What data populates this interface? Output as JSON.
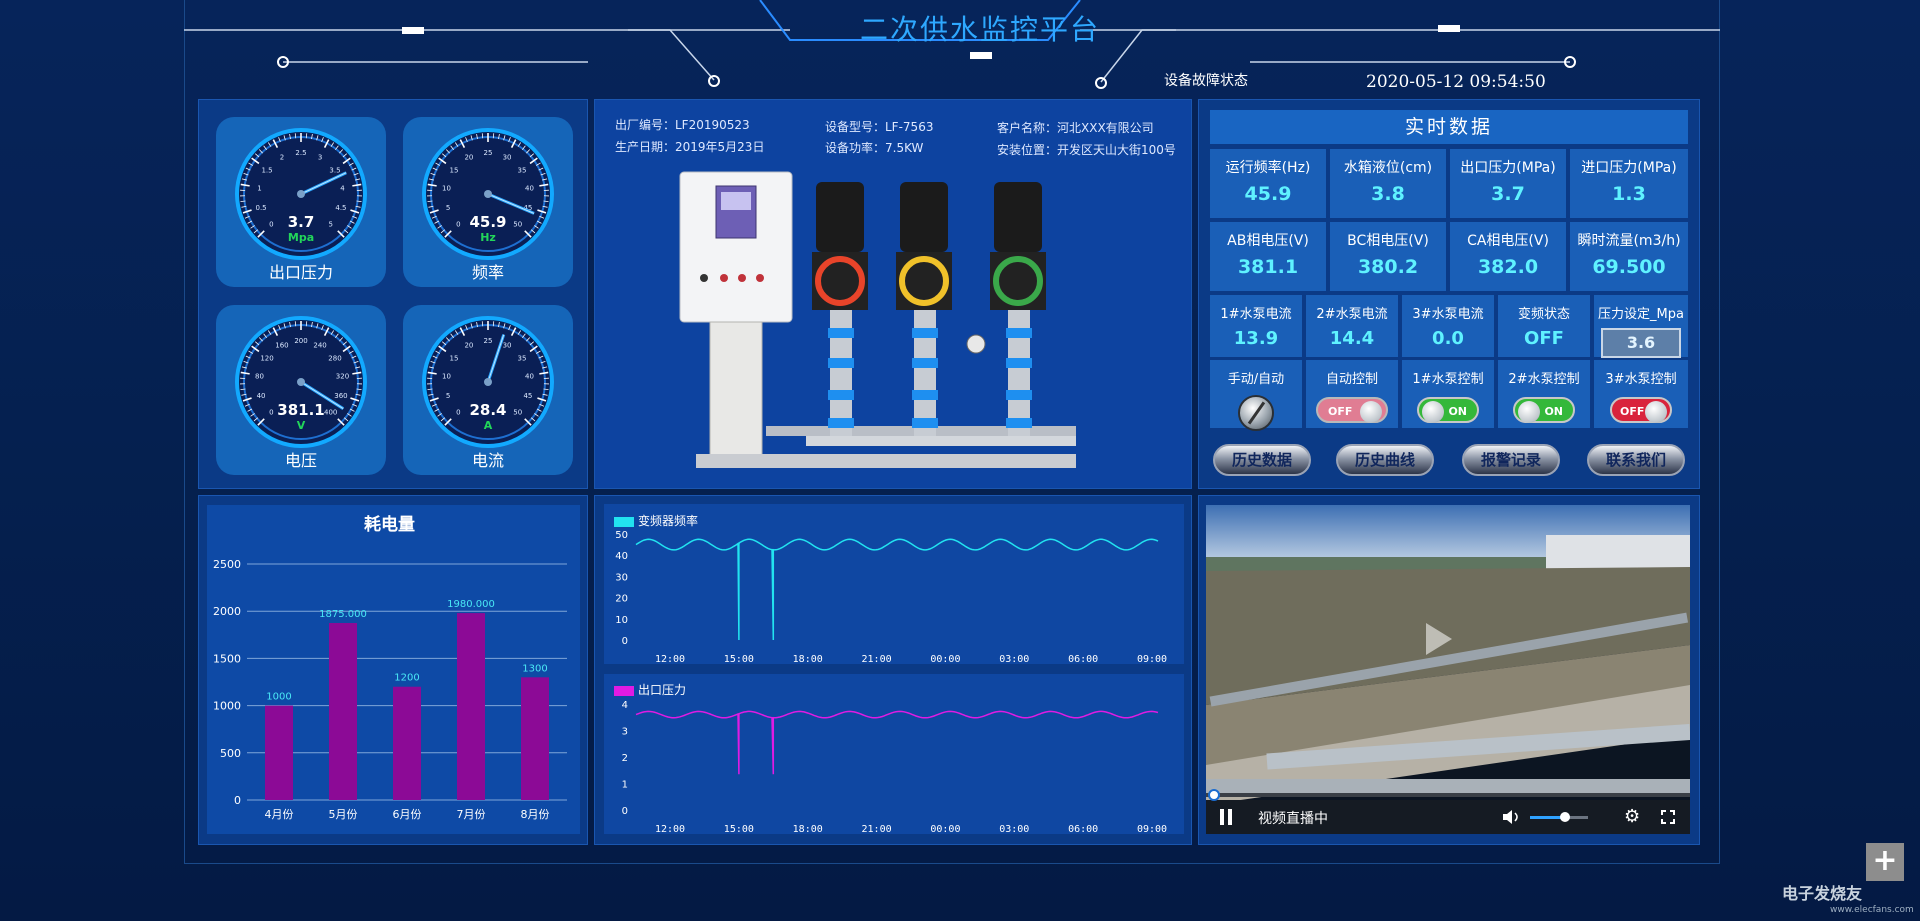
{
  "header": {
    "title": "二次供水监控平台",
    "fault_status": "设备故障状态",
    "datetime": "2020-05-12  09:54:50"
  },
  "gauges": [
    {
      "value": "3.7",
      "unit": "Mpa",
      "label": "出口压力",
      "min": 0,
      "max": 5,
      "ticks": [
        "0",
        "0.5",
        "1",
        "1.5",
        "2",
        "2.5",
        "3",
        "3.5",
        "4",
        "4.5",
        "5"
      ]
    },
    {
      "value": "45.9",
      "unit": "Hz",
      "label": "频率",
      "min": 0,
      "max": 50,
      "ticks": [
        "0",
        "5",
        "10",
        "15",
        "20",
        "25",
        "30",
        "35",
        "40",
        "45",
        "50"
      ]
    },
    {
      "value": "381.1",
      "unit": "V",
      "label": "电压",
      "min": 0,
      "max": 400,
      "ticks": [
        "0",
        "40",
        "80",
        "120",
        "160",
        "200",
        "240",
        "280",
        "320",
        "360",
        "400"
      ]
    },
    {
      "value": "28.4",
      "unit": "A",
      "label": "电流",
      "min": 0,
      "max": 50,
      "ticks": [
        "0",
        "5",
        "10",
        "15",
        "20",
        "25",
        "30",
        "35",
        "40",
        "45",
        "50"
      ]
    }
  ],
  "device_info": {
    "factory_no": "出厂编号：LF20190523",
    "production_date": "生产日期：2019年5月23日",
    "model": "设备型号：LF-7563",
    "power": "设备功率：7.5KW",
    "customer": "客户名称：河北XXX有限公司",
    "location": "安装位置：开发区天山大街100号"
  },
  "realtime": {
    "title": "实时数据",
    "row1": [
      {
        "label": "运行频率(Hz)",
        "value": "45.9"
      },
      {
        "label": "水箱液位(cm)",
        "value": "3.8"
      },
      {
        "label": "出口压力(MPa)",
        "value": "3.7"
      },
      {
        "label": "进口压力(MPa)",
        "value": "1.3"
      }
    ],
    "row2": [
      {
        "label": "AB相电压(V)",
        "value": "381.1"
      },
      {
        "label": "BC相电压(V)",
        "value": "380.2"
      },
      {
        "label": "CA相电压(V)",
        "value": "382.0"
      },
      {
        "label": "瞬时流量(m3/h)",
        "value": "69.500"
      }
    ],
    "row3": [
      {
        "label": "1#水泵电流",
        "value": "13.9"
      },
      {
        "label": "2#水泵电流",
        "value": "14.4"
      },
      {
        "label": "3#水泵电流",
        "value": "0.0"
      },
      {
        "label": "变频状态",
        "value": "OFF"
      },
      {
        "label": "压力设定_Mpa",
        "value": "3.6"
      }
    ],
    "row4": [
      {
        "label": "手动/自动",
        "state": ""
      },
      {
        "label": "自动控制",
        "state": "OFF"
      },
      {
        "label": "1#水泵控制",
        "state": "ON"
      },
      {
        "label": "2#水泵控制",
        "state": "ON"
      },
      {
        "label": "3#水泵控制",
        "state": "OFF"
      }
    ],
    "buttons": [
      "历史数据",
      "历史曲线",
      "报警记录",
      "联系我们"
    ]
  },
  "video": {
    "status": "视频直播中",
    "volume": 0.6
  },
  "watermark": {
    "brand": "电子发烧友",
    "url": "www.elecfans.com"
  },
  "chart_data": [
    {
      "type": "bar",
      "title": "耗电量",
      "categories": [
        "4月份",
        "5月份",
        "6月份",
        "7月份",
        "8月份"
      ],
      "values": [
        1000,
        1875,
        1200,
        1980,
        1300
      ],
      "data_labels": [
        "1000",
        "1875.000",
        "1200",
        "1980.000",
        "1300"
      ],
      "y_ticks": [
        "0",
        "500",
        "1000",
        "1500",
        "2000",
        "2500"
      ],
      "ylim": [
        0,
        2500
      ],
      "color": "#8c0a96"
    },
    {
      "type": "line",
      "legend": "变频器频率",
      "color": "#22e3f0",
      "x_ticks": [
        "12:00",
        "15:00",
        "18:00",
        "21:00",
        "00:00",
        "03:00",
        "06:00",
        "09:00"
      ],
      "y_ticks": [
        "0",
        "10",
        "20",
        "30",
        "40",
        "50"
      ],
      "ylim": [
        0,
        50
      ],
      "baseline": 45,
      "amplitude": 2.5,
      "dips": [
        {
          "x": "15:00",
          "value": 0
        },
        {
          "x": "16:30",
          "value": 0
        }
      ]
    },
    {
      "type": "line",
      "legend": "出口压力",
      "color": "#e01be3",
      "x_ticks": [
        "12:00",
        "15:00",
        "18:00",
        "21:00",
        "00:00",
        "03:00",
        "06:00",
        "09:00"
      ],
      "y_ticks": [
        "0",
        "1",
        "2",
        "3",
        "4"
      ],
      "ylim": [
        0,
        4
      ],
      "baseline": 3.6,
      "amplitude": 0.12,
      "dips": [
        {
          "x": "15:00",
          "value": 1.35
        },
        {
          "x": "16:30",
          "value": 1.35
        }
      ]
    }
  ]
}
